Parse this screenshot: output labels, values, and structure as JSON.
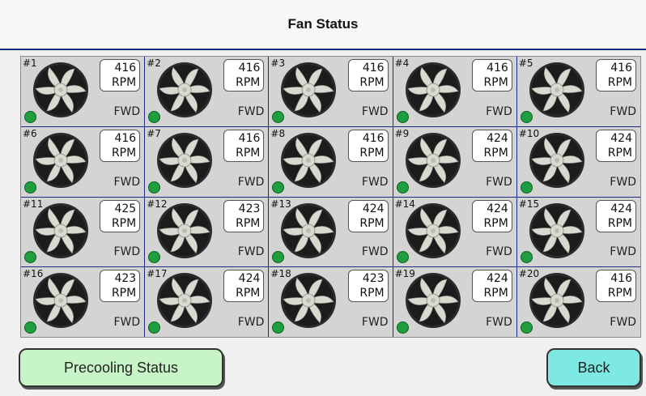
{
  "header": {
    "title": "Fan Status"
  },
  "fans": [
    {
      "num": "#1",
      "rpm": "416",
      "unit": "RPM",
      "dir": "FWD"
    },
    {
      "num": "#2",
      "rpm": "416",
      "unit": "RPM",
      "dir": "FWD"
    },
    {
      "num": "#3",
      "rpm": "416",
      "unit": "RPM",
      "dir": "FWD"
    },
    {
      "num": "#4",
      "rpm": "416",
      "unit": "RPM",
      "dir": "FWD"
    },
    {
      "num": "#5",
      "rpm": "416",
      "unit": "RPM",
      "dir": "FWD"
    },
    {
      "num": "#6",
      "rpm": "416",
      "unit": "RPM",
      "dir": "FWD"
    },
    {
      "num": "#7",
      "rpm": "416",
      "unit": "RPM",
      "dir": "FWD"
    },
    {
      "num": "#8",
      "rpm": "416",
      "unit": "RPM",
      "dir": "FWD"
    },
    {
      "num": "#9",
      "rpm": "424",
      "unit": "RPM",
      "dir": "FWD"
    },
    {
      "num": "#10",
      "rpm": "424",
      "unit": "RPM",
      "dir": "FWD"
    },
    {
      "num": "#11",
      "rpm": "425",
      "unit": "RPM",
      "dir": "FWD"
    },
    {
      "num": "#12",
      "rpm": "423",
      "unit": "RPM",
      "dir": "FWD"
    },
    {
      "num": "#13",
      "rpm": "424",
      "unit": "RPM",
      "dir": "FWD"
    },
    {
      "num": "#14",
      "rpm": "424",
      "unit": "RPM",
      "dir": "FWD"
    },
    {
      "num": "#15",
      "rpm": "424",
      "unit": "RPM",
      "dir": "FWD"
    },
    {
      "num": "#16",
      "rpm": "423",
      "unit": "RPM",
      "dir": "FWD"
    },
    {
      "num": "#17",
      "rpm": "424",
      "unit": "RPM",
      "dir": "FWD"
    },
    {
      "num": "#18",
      "rpm": "423",
      "unit": "RPM",
      "dir": "FWD"
    },
    {
      "num": "#19",
      "rpm": "424",
      "unit": "RPM",
      "dir": "FWD"
    },
    {
      "num": "#20",
      "rpm": "416",
      "unit": "RPM",
      "dir": "FWD"
    }
  ],
  "status_color": "#1e9e3e",
  "buttons": {
    "precooling_label": "Precooling Status",
    "back_label": "Back"
  }
}
